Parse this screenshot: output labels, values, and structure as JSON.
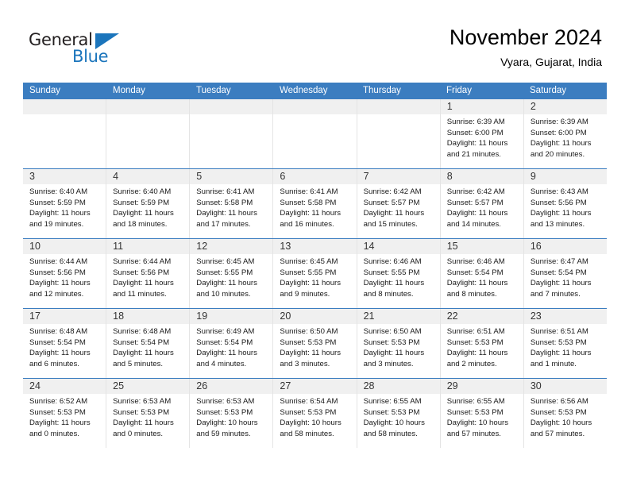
{
  "branding": {
    "logo_text_primary": "General",
    "logo_text_secondary": "Blue",
    "logo_accent_color": "#1b75bc"
  },
  "header": {
    "title": "November 2024",
    "subtitle": "Vyara, Gujarat, India"
  },
  "theme": {
    "header_bg": "#3b7dc0",
    "header_text": "#ffffff",
    "day_strip_bg": "#f0f0f0",
    "cell_border": "#e4e4e4"
  },
  "weekdays": [
    "Sunday",
    "Monday",
    "Tuesday",
    "Wednesday",
    "Thursday",
    "Friday",
    "Saturday"
  ],
  "weeks": [
    [
      {
        "day": "",
        "lines": []
      },
      {
        "day": "",
        "lines": []
      },
      {
        "day": "",
        "lines": []
      },
      {
        "day": "",
        "lines": []
      },
      {
        "day": "",
        "lines": []
      },
      {
        "day": "1",
        "lines": [
          "Sunrise: 6:39 AM",
          "Sunset: 6:00 PM",
          "Daylight: 11 hours",
          "and 21 minutes."
        ]
      },
      {
        "day": "2",
        "lines": [
          "Sunrise: 6:39 AM",
          "Sunset: 6:00 PM",
          "Daylight: 11 hours",
          "and 20 minutes."
        ]
      }
    ],
    [
      {
        "day": "3",
        "lines": [
          "Sunrise: 6:40 AM",
          "Sunset: 5:59 PM",
          "Daylight: 11 hours",
          "and 19 minutes."
        ]
      },
      {
        "day": "4",
        "lines": [
          "Sunrise: 6:40 AM",
          "Sunset: 5:59 PM",
          "Daylight: 11 hours",
          "and 18 minutes."
        ]
      },
      {
        "day": "5",
        "lines": [
          "Sunrise: 6:41 AM",
          "Sunset: 5:58 PM",
          "Daylight: 11 hours",
          "and 17 minutes."
        ]
      },
      {
        "day": "6",
        "lines": [
          "Sunrise: 6:41 AM",
          "Sunset: 5:58 PM",
          "Daylight: 11 hours",
          "and 16 minutes."
        ]
      },
      {
        "day": "7",
        "lines": [
          "Sunrise: 6:42 AM",
          "Sunset: 5:57 PM",
          "Daylight: 11 hours",
          "and 15 minutes."
        ]
      },
      {
        "day": "8",
        "lines": [
          "Sunrise: 6:42 AM",
          "Sunset: 5:57 PM",
          "Daylight: 11 hours",
          "and 14 minutes."
        ]
      },
      {
        "day": "9",
        "lines": [
          "Sunrise: 6:43 AM",
          "Sunset: 5:56 PM",
          "Daylight: 11 hours",
          "and 13 minutes."
        ]
      }
    ],
    [
      {
        "day": "10",
        "lines": [
          "Sunrise: 6:44 AM",
          "Sunset: 5:56 PM",
          "Daylight: 11 hours",
          "and 12 minutes."
        ]
      },
      {
        "day": "11",
        "lines": [
          "Sunrise: 6:44 AM",
          "Sunset: 5:56 PM",
          "Daylight: 11 hours",
          "and 11 minutes."
        ]
      },
      {
        "day": "12",
        "lines": [
          "Sunrise: 6:45 AM",
          "Sunset: 5:55 PM",
          "Daylight: 11 hours",
          "and 10 minutes."
        ]
      },
      {
        "day": "13",
        "lines": [
          "Sunrise: 6:45 AM",
          "Sunset: 5:55 PM",
          "Daylight: 11 hours",
          "and 9 minutes."
        ]
      },
      {
        "day": "14",
        "lines": [
          "Sunrise: 6:46 AM",
          "Sunset: 5:55 PM",
          "Daylight: 11 hours",
          "and 8 minutes."
        ]
      },
      {
        "day": "15",
        "lines": [
          "Sunrise: 6:46 AM",
          "Sunset: 5:54 PM",
          "Daylight: 11 hours",
          "and 8 minutes."
        ]
      },
      {
        "day": "16",
        "lines": [
          "Sunrise: 6:47 AM",
          "Sunset: 5:54 PM",
          "Daylight: 11 hours",
          "and 7 minutes."
        ]
      }
    ],
    [
      {
        "day": "17",
        "lines": [
          "Sunrise: 6:48 AM",
          "Sunset: 5:54 PM",
          "Daylight: 11 hours",
          "and 6 minutes."
        ]
      },
      {
        "day": "18",
        "lines": [
          "Sunrise: 6:48 AM",
          "Sunset: 5:54 PM",
          "Daylight: 11 hours",
          "and 5 minutes."
        ]
      },
      {
        "day": "19",
        "lines": [
          "Sunrise: 6:49 AM",
          "Sunset: 5:54 PM",
          "Daylight: 11 hours",
          "and 4 minutes."
        ]
      },
      {
        "day": "20",
        "lines": [
          "Sunrise: 6:50 AM",
          "Sunset: 5:53 PM",
          "Daylight: 11 hours",
          "and 3 minutes."
        ]
      },
      {
        "day": "21",
        "lines": [
          "Sunrise: 6:50 AM",
          "Sunset: 5:53 PM",
          "Daylight: 11 hours",
          "and 3 minutes."
        ]
      },
      {
        "day": "22",
        "lines": [
          "Sunrise: 6:51 AM",
          "Sunset: 5:53 PM",
          "Daylight: 11 hours",
          "and 2 minutes."
        ]
      },
      {
        "day": "23",
        "lines": [
          "Sunrise: 6:51 AM",
          "Sunset: 5:53 PM",
          "Daylight: 11 hours",
          "and 1 minute."
        ]
      }
    ],
    [
      {
        "day": "24",
        "lines": [
          "Sunrise: 6:52 AM",
          "Sunset: 5:53 PM",
          "Daylight: 11 hours",
          "and 0 minutes."
        ]
      },
      {
        "day": "25",
        "lines": [
          "Sunrise: 6:53 AM",
          "Sunset: 5:53 PM",
          "Daylight: 11 hours",
          "and 0 minutes."
        ]
      },
      {
        "day": "26",
        "lines": [
          "Sunrise: 6:53 AM",
          "Sunset: 5:53 PM",
          "Daylight: 10 hours",
          "and 59 minutes."
        ]
      },
      {
        "day": "27",
        "lines": [
          "Sunrise: 6:54 AM",
          "Sunset: 5:53 PM",
          "Daylight: 10 hours",
          "and 58 minutes."
        ]
      },
      {
        "day": "28",
        "lines": [
          "Sunrise: 6:55 AM",
          "Sunset: 5:53 PM",
          "Daylight: 10 hours",
          "and 58 minutes."
        ]
      },
      {
        "day": "29",
        "lines": [
          "Sunrise: 6:55 AM",
          "Sunset: 5:53 PM",
          "Daylight: 10 hours",
          "and 57 minutes."
        ]
      },
      {
        "day": "30",
        "lines": [
          "Sunrise: 6:56 AM",
          "Sunset: 5:53 PM",
          "Daylight: 10 hours",
          "and 57 minutes."
        ]
      }
    ]
  ]
}
